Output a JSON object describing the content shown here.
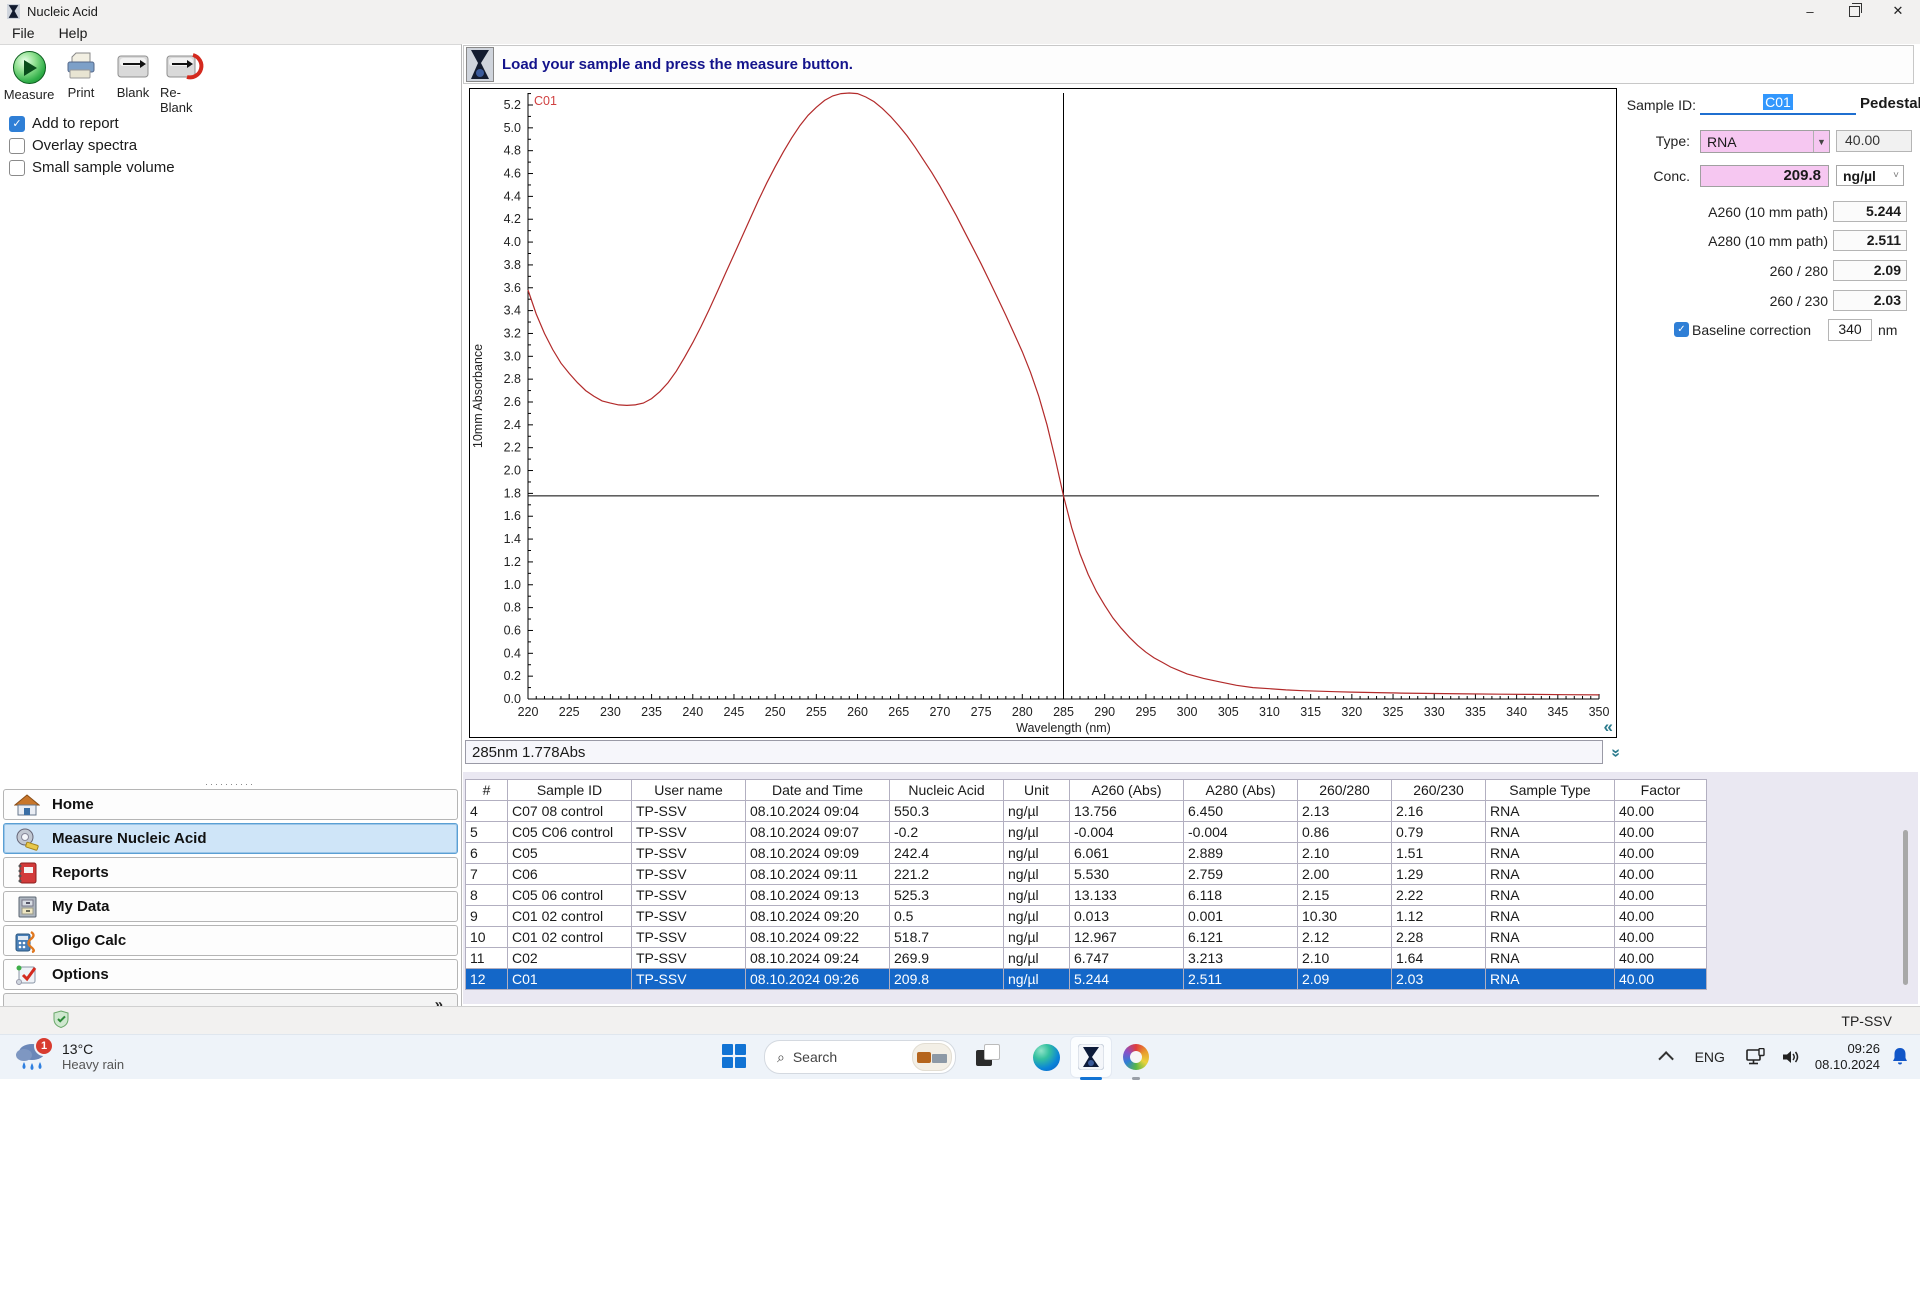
{
  "colors": {
    "accent_blue": "#1467c8",
    "selection_blue": "#3297fd",
    "pink_field": "#f6c7f1",
    "curve_red": "#b22a2a",
    "message_navy": "#14148c",
    "teal_control": "#2a7a8c"
  },
  "window": {
    "title": "Nucleic Acid",
    "menu": [
      {
        "label": "File"
      },
      {
        "label": "Help"
      }
    ]
  },
  "toolbar": {
    "buttons": [
      {
        "label": "Measure"
      },
      {
        "label": "Print"
      },
      {
        "label": "Blank"
      },
      {
        "label": "Re-Blank"
      }
    ]
  },
  "checkboxes": [
    {
      "label": "Add to report",
      "checked": true
    },
    {
      "label": "Overlay spectra",
      "checked": false
    },
    {
      "label": "Small sample volume",
      "checked": false
    }
  ],
  "sidebar": {
    "items": [
      {
        "label": "Home"
      },
      {
        "label": "Measure Nucleic Acid"
      },
      {
        "label": "Reports"
      },
      {
        "label": "My Data"
      },
      {
        "label": "Oligo Calc"
      },
      {
        "label": "Options"
      }
    ],
    "selected_index": 1,
    "footer_chevron": "»"
  },
  "message_bar": {
    "text": "Load your sample and press the measure button."
  },
  "chart_data": {
    "type": "line",
    "title": "",
    "xlabel": "Wavelength (nm)",
    "ylabel": "10mm Absorbance",
    "xlim": [
      220,
      350
    ],
    "ylim": [
      0,
      5.305
    ],
    "xticks": [
      220,
      225,
      230,
      235,
      240,
      245,
      250,
      255,
      260,
      265,
      270,
      275,
      280,
      285,
      290,
      295,
      300,
      305,
      310,
      315,
      320,
      325,
      330,
      335,
      340,
      345,
      350
    ],
    "yticks": [
      0.0,
      0.2,
      0.4,
      0.6,
      0.8,
      1.0,
      1.2,
      1.4,
      1.6,
      1.8,
      2.0,
      2.2,
      2.4,
      2.6,
      2.8,
      3.0,
      3.2,
      3.4,
      3.6,
      3.8,
      4.0,
      4.2,
      4.4,
      4.6,
      4.8,
      5.0,
      5.2
    ],
    "grid": false,
    "legend_position": "top-left-inside",
    "cursor": {
      "x": 285,
      "y": 1.778
    },
    "readout": "285nm 1.778Abs",
    "series": [
      {
        "name": "C01",
        "color": "#b22a2a",
        "points": [
          [
            220,
            3.58
          ],
          [
            221,
            3.37
          ],
          [
            222,
            3.2
          ],
          [
            223,
            3.06
          ],
          [
            224,
            2.94
          ],
          [
            225,
            2.85
          ],
          [
            226,
            2.77
          ],
          [
            227,
            2.7
          ],
          [
            228,
            2.65
          ],
          [
            229,
            2.61
          ],
          [
            230,
            2.59
          ],
          [
            231,
            2.575
          ],
          [
            232,
            2.57
          ],
          [
            233,
            2.575
          ],
          [
            234,
            2.59
          ],
          [
            235,
            2.63
          ],
          [
            236,
            2.69
          ],
          [
            237,
            2.77
          ],
          [
            238,
            2.87
          ],
          [
            239,
            2.99
          ],
          [
            240,
            3.12
          ],
          [
            241,
            3.26
          ],
          [
            242,
            3.41
          ],
          [
            243,
            3.57
          ],
          [
            244,
            3.73
          ],
          [
            245,
            3.89
          ],
          [
            246,
            4.05
          ],
          [
            247,
            4.21
          ],
          [
            248,
            4.37
          ],
          [
            249,
            4.52
          ],
          [
            250,
            4.66
          ],
          [
            251,
            4.79
          ],
          [
            252,
            4.91
          ],
          [
            253,
            5.02
          ],
          [
            254,
            5.11
          ],
          [
            255,
            5.18
          ],
          [
            256,
            5.24
          ],
          [
            257,
            5.28
          ],
          [
            258,
            5.3
          ],
          [
            259,
            5.305
          ],
          [
            260,
            5.3
          ],
          [
            261,
            5.27
          ],
          [
            262,
            5.23
          ],
          [
            263,
            5.17
          ],
          [
            264,
            5.1
          ],
          [
            265,
            5.02
          ],
          [
            266,
            4.93
          ],
          [
            267,
            4.83
          ],
          [
            268,
            4.72
          ],
          [
            269,
            4.61
          ],
          [
            270,
            4.49
          ],
          [
            271,
            4.36
          ],
          [
            272,
            4.23
          ],
          [
            273,
            4.09
          ],
          [
            274,
            3.95
          ],
          [
            275,
            3.81
          ],
          [
            276,
            3.66
          ],
          [
            277,
            3.51
          ],
          [
            278,
            3.36
          ],
          [
            279,
            3.2
          ],
          [
            280,
            3.04
          ],
          [
            281,
            2.86
          ],
          [
            282,
            2.65
          ],
          [
            283,
            2.4
          ],
          [
            284,
            2.1
          ],
          [
            285,
            1.778
          ],
          [
            286,
            1.5
          ],
          [
            287,
            1.27
          ],
          [
            288,
            1.09
          ],
          [
            289,
            0.94
          ],
          [
            290,
            0.82
          ],
          [
            291,
            0.71
          ],
          [
            292,
            0.62
          ],
          [
            293,
            0.54
          ],
          [
            294,
            0.47
          ],
          [
            295,
            0.41
          ],
          [
            296,
            0.36
          ],
          [
            297,
            0.32
          ],
          [
            298,
            0.28
          ],
          [
            299,
            0.25
          ],
          [
            300,
            0.22
          ],
          [
            302,
            0.18
          ],
          [
            304,
            0.15
          ],
          [
            306,
            0.12
          ],
          [
            308,
            0.1
          ],
          [
            310,
            0.09
          ],
          [
            312,
            0.08
          ],
          [
            314,
            0.073
          ],
          [
            316,
            0.068
          ],
          [
            318,
            0.064
          ],
          [
            320,
            0.06
          ],
          [
            323,
            0.056
          ],
          [
            326,
            0.052
          ],
          [
            330,
            0.048
          ],
          [
            334,
            0.045
          ],
          [
            338,
            0.042
          ],
          [
            342,
            0.04
          ],
          [
            346,
            0.038
          ],
          [
            350,
            0.036
          ]
        ]
      }
    ]
  },
  "sample_panel": {
    "sample_id_label": "Sample ID:",
    "sample_id_value": "C01",
    "mode": "Pedestal",
    "type_label": "Type:",
    "type_value": "RNA",
    "factor_value": "40.00",
    "conc_label": "Conc.",
    "conc_value": "209.8",
    "conc_unit": "ng/µl",
    "unit_arrow": "˅",
    "dropdown_arrow": "▼",
    "a260_label": "A260 (10 mm path)",
    "a260_value": "5.244",
    "a280_label": "A280 (10 mm path)",
    "a280_value": "2.511",
    "r260_280_label": "260 / 280",
    "r260_280_value": "2.09",
    "r260_230_label": "260 / 230",
    "r260_230_value": "2.03",
    "baseline_label": "Baseline correction",
    "baseline_value": "340",
    "baseline_unit": "nm"
  },
  "controls": {
    "collapse_glyph": "«",
    "expand_glyph": "»",
    "check_glyph": "✓"
  },
  "table": {
    "columns": [
      "#",
      "Sample ID",
      "User name",
      "Date and Time",
      "Nucleic Acid",
      "Unit",
      "A260 (Abs)",
      "A280 (Abs)",
      "260/280",
      "260/230",
      "Sample Type",
      "Factor"
    ],
    "rows": [
      [
        "4",
        "C07 08 control",
        "TP-SSV",
        "08.10.2024 09:04",
        "550.3",
        "ng/µl",
        "13.756",
        "6.450",
        "2.13",
        "2.16",
        "RNA",
        "40.00"
      ],
      [
        "5",
        "C05 C06 control",
        "TP-SSV",
        "08.10.2024 09:07",
        "-0.2",
        "ng/µl",
        "-0.004",
        "-0.004",
        "0.86",
        "0.79",
        "RNA",
        "40.00"
      ],
      [
        "6",
        "C05",
        "TP-SSV",
        "08.10.2024 09:09",
        "242.4",
        "ng/µl",
        "6.061",
        "2.889",
        "2.10",
        "1.51",
        "RNA",
        "40.00"
      ],
      [
        "7",
        "C06",
        "TP-SSV",
        "08.10.2024 09:11",
        "221.2",
        "ng/µl",
        "5.530",
        "2.759",
        "2.00",
        "1.29",
        "RNA",
        "40.00"
      ],
      [
        "8",
        "C05 06 control",
        "TP-SSV",
        "08.10.2024 09:13",
        "525.3",
        "ng/µl",
        "13.133",
        "6.118",
        "2.15",
        "2.22",
        "RNA",
        "40.00"
      ],
      [
        "9",
        "C01 02 control",
        "TP-SSV",
        "08.10.2024 09:20",
        "0.5",
        "ng/µl",
        "0.013",
        "0.001",
        "10.30",
        "1.12",
        "RNA",
        "40.00"
      ],
      [
        "10",
        "C01 02 control",
        "TP-SSV",
        "08.10.2024 09:22",
        "518.7",
        "ng/µl",
        "12.967",
        "6.121",
        "2.12",
        "2.28",
        "RNA",
        "40.00"
      ],
      [
        "11",
        "C02",
        "TP-SSV",
        "08.10.2024 09:24",
        "269.9",
        "ng/µl",
        "6.747",
        "3.213",
        "2.10",
        "1.64",
        "RNA",
        "40.00"
      ],
      [
        "12",
        "C01",
        "TP-SSV",
        "08.10.2024 09:26",
        "209.8",
        "ng/µl",
        "5.244",
        "2.511",
        "2.09",
        "2.03",
        "RNA",
        "40.00"
      ]
    ],
    "selected_row_index": 8
  },
  "statusbar": {
    "user": "TP-SSV"
  },
  "taskbar": {
    "weather": {
      "badge": "1",
      "temp": "13°C",
      "condition": "Heavy rain"
    },
    "search_placeholder": "Search",
    "language": "ENG",
    "time": "09:26",
    "date": "08.10.2024"
  }
}
